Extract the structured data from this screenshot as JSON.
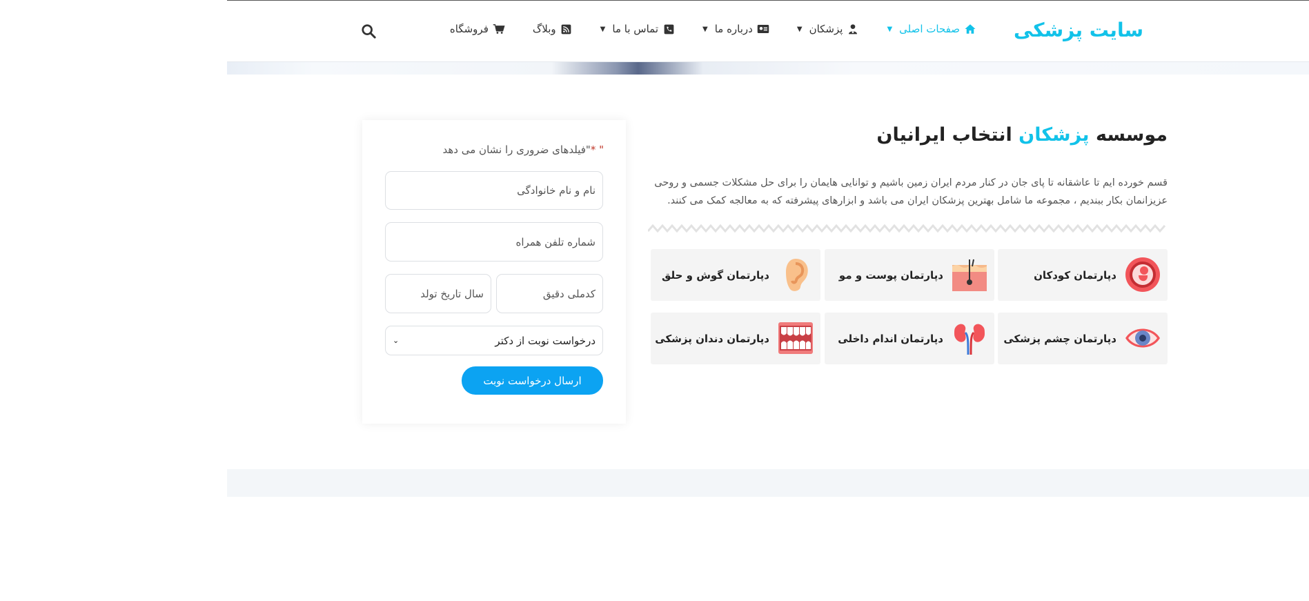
{
  "header": {
    "logo": "سایت پزشکی",
    "nav": [
      {
        "label": "صفحات اصلی",
        "icon": "home-icon",
        "has_dropdown": true,
        "active": true
      },
      {
        "label": "پزشکان",
        "icon": "doctor-icon",
        "has_dropdown": true,
        "active": false
      },
      {
        "label": "درباره ما",
        "icon": "id-card-icon",
        "has_dropdown": true,
        "active": false
      },
      {
        "label": "تماس با ما",
        "icon": "phone-icon",
        "has_dropdown": true,
        "active": false
      },
      {
        "label": "وبلاگ",
        "icon": "rss-icon",
        "has_dropdown": false,
        "active": false
      },
      {
        "label": "فروشگاه",
        "icon": "cart-icon",
        "has_dropdown": false,
        "active": false
      }
    ],
    "search_icon": "search-icon"
  },
  "intro": {
    "title_part1": "موسسه",
    "title_highlight": "پزشکان",
    "title_part2": "انتخاب ایرانیان",
    "text": "قسم خورده ایم تا عاشقانه تا پای جان در کنار مردم ایران زمین باشیم و توانایی هایمان را برای حل مشکلات جسمی و روحی عزیزانمان بکار ببندیم ، مجموعه ما شامل بهترین پزشکان ایران می باشد و ابزارهای پیشرفته که به معالجه کمک می کنند."
  },
  "departments": [
    {
      "label": "دپارتمان کودکان",
      "icon": "fetus-icon"
    },
    {
      "label": "دپارتمان پوست و مو",
      "icon": "skin-hair-icon"
    },
    {
      "label": "دپارتمان گوش و حلق",
      "icon": "ear-icon"
    },
    {
      "label": "دپارتمان چشم پزشکی",
      "icon": "eye-icon"
    },
    {
      "label": "دپارتمان اندام داخلی",
      "icon": "kidney-icon"
    },
    {
      "label": "دپارتمان دندان پزشکی",
      "icon": "teeth-icon"
    }
  ],
  "form": {
    "required_note_prefix": "\"",
    "required_star": "*",
    "required_note": "\"فیلدهای ضروری را نشان می دهد",
    "name_placeholder": "نام و نام خانوادگی",
    "phone_placeholder": "شماره تلفن همراه",
    "national_code_placeholder": "کدملی دقیق",
    "birth_year_placeholder": "سال تاریخ تولد",
    "select_value": "درخواست نوبت از دکتر",
    "submit_label": "ارسال درخواست نوبت"
  },
  "colors": {
    "accent": "#12c2e9",
    "button": "#0ca3f2",
    "card_bg": "#f4f4f4"
  }
}
